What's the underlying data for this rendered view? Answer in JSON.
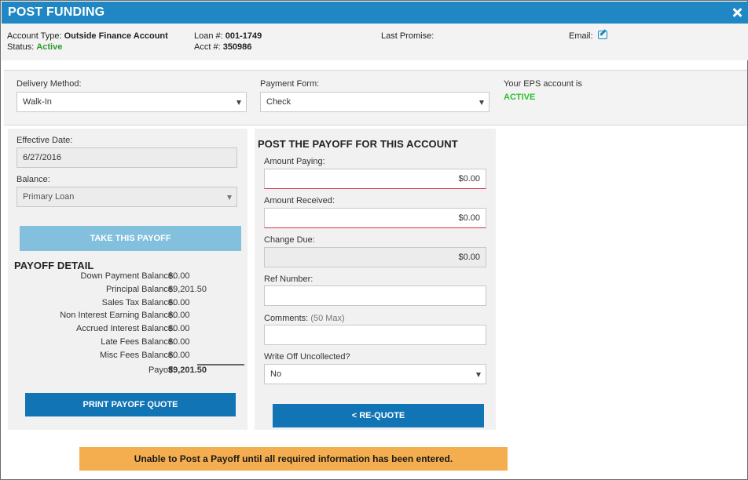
{
  "window": {
    "title": "POST FUNDING"
  },
  "account": {
    "type_label": "Account Type:",
    "type_value": "Outside Finance Account",
    "status_label": "Status:",
    "status_value": "Active",
    "loan_label": "Loan #:",
    "loan_value": "001-1749",
    "acct_label": "Acct #:",
    "acct_value": "350986",
    "last_promise_label": "Last Promise:",
    "email_label": "Email:"
  },
  "delivery": {
    "method_label": "Delivery Method:",
    "method_value": "Walk-In",
    "payment_form_label": "Payment Form:",
    "payment_form_value": "Check",
    "eps_label": "Your EPS account is",
    "eps_value": "ACTIVE"
  },
  "left": {
    "effective_date_label": "Effective Date:",
    "effective_date_value": "6/27/2016",
    "balance_label": "Balance:",
    "balance_value": "Primary Loan",
    "take_payoff_button": "TAKE THIS PAYOFF",
    "payoff_detail_title": "PAYOFF DETAIL",
    "payoff_detail": [
      {
        "label": "Down Payment Balance:",
        "value": "$0.00"
      },
      {
        "label": "Principal Balance:",
        "value": "$9,201.50"
      },
      {
        "label": "Sales Tax Balance:",
        "value": "$0.00"
      },
      {
        "label": "Non Interest Earning Balance:",
        "value": "$0.00"
      },
      {
        "label": "Accrued Interest Balance:",
        "value": "$0.00"
      },
      {
        "label": "Late Fees Balance:",
        "value": "$0.00"
      },
      {
        "label": "Misc Fees Balance:",
        "value": "$0.00"
      }
    ],
    "payoff_total_label": "Payoff:",
    "payoff_total_value": "$9,201.50",
    "print_button": "PRINT PAYOFF QUOTE"
  },
  "right": {
    "title": "POST THE PAYOFF FOR THIS ACCOUNT",
    "amount_paying_label": "Amount Paying:",
    "amount_paying_value": "$0.00",
    "amount_received_label": "Amount Received:",
    "amount_received_value": "$0.00",
    "change_due_label": "Change Due:",
    "change_due_value": "$0.00",
    "ref_number_label": "Ref Number:",
    "ref_number_value": "",
    "comments_label": "Comments:",
    "comments_hint": "(50 Max)",
    "comments_value": "",
    "write_off_label": "Write Off Uncollected?",
    "write_off_value": "No",
    "requote_button": "< RE-QUOTE"
  },
  "warning": "Unable to Post a Payoff until all required information has been entered.",
  "colors": {
    "title_bar": "#1f88c4",
    "active_green": "#2e9a2e",
    "eps_green": "#2ec02e",
    "required_border": "#d4334c",
    "button_blue": "#1174b5",
    "button_disabled": "#82c0de",
    "warning_bg": "#f5ae4f"
  }
}
